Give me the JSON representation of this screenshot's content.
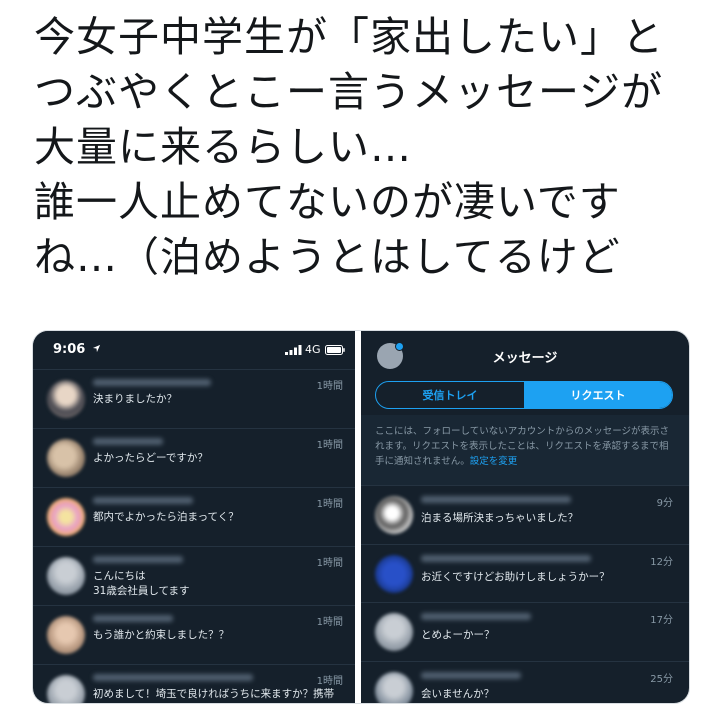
{
  "tweet": {
    "text": "今女子中学生が「家出したい」と\nつぶやくとこー言うメッセージが\n大量に来るらしい…\n誰一人止めてないのが凄いです\nね…（泊めようとはしてるけど"
  },
  "left_screen": {
    "time": "9:06",
    "network": "4G",
    "messages": [
      {
        "time": "1時間",
        "text": "決まりましたか？"
      },
      {
        "time": "1時間",
        "text": "よかったらどーですか？"
      },
      {
        "time": "1時間",
        "text": "都内でよかったら泊まってく？"
      },
      {
        "time": "1時間",
        "text": "こんにちは\n31歳会社員してます"
      },
      {
        "time": "1時間",
        "text": "もう誰かと約束しました？？"
      },
      {
        "time": "1時間",
        "text": "初めまして！埼玉で良ければうちに来ますか？携帯"
      }
    ]
  },
  "right_screen": {
    "title": "メッセージ",
    "tabs": {
      "inbox": "受信トレイ",
      "requests": "リクエスト"
    },
    "notice": "ここには、フォローしていないアカウントからのメッセージが表示されます。リクエストを表示したことは、リクエストを承認するまで相手に通知されません。",
    "notice_link": "設定を変更",
    "messages": [
      {
        "time": "9分",
        "text": "泊まる場所決まっちゃいました？"
      },
      {
        "time": "12分",
        "text": "お近くですけどお助けしましょうかー？"
      },
      {
        "time": "17分",
        "text": "とめよーかー？"
      },
      {
        "time": "25分",
        "text": "会いませんか？"
      }
    ]
  },
  "colors": {
    "panel_bg": "#15202b",
    "accent": "#1da1f2",
    "secondary_text": "#8899a6"
  }
}
